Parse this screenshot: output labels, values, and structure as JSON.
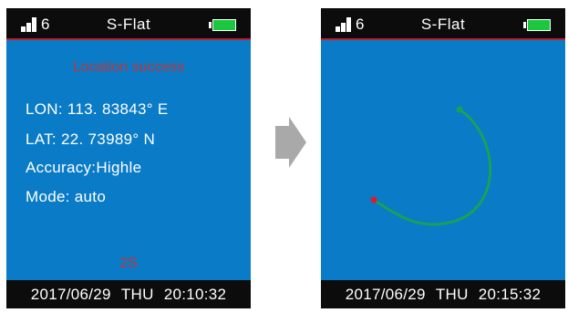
{
  "left_screen": {
    "status_bar": {
      "signal_count": "6",
      "title": "S-Flat",
      "battery": "full"
    },
    "location_status": "Location success",
    "lon": {
      "label": "LON:",
      "value": "113. 83843° E"
    },
    "lat": {
      "label": "LAT:",
      "value": "22. 73989° N"
    },
    "accuracy": {
      "label": "Accuracy:",
      "value": "Highle"
    },
    "mode": {
      "label": "Mode:",
      "value": "auto"
    },
    "countdown": "2S",
    "footer": {
      "date": "2017/06/29",
      "day": "THU",
      "time": "20:10:32"
    }
  },
  "right_screen": {
    "status_bar": {
      "signal_count": "6",
      "title": "S-Flat",
      "battery": "full"
    },
    "footer": {
      "date": "2017/06/29",
      "day": "THU",
      "time": "20:15:32"
    }
  },
  "icons": [
    "signal-bars-icon",
    "battery-icon",
    "right-arrow-icon"
  ],
  "colors": {
    "screen_bg": "#0a7bc6",
    "bar_bg": "#0c0c0c",
    "accent_red": "#c0343a",
    "battery_green": "#1bc73f",
    "track_green": "#1aa05a",
    "track_start": "#e01a2a"
  }
}
